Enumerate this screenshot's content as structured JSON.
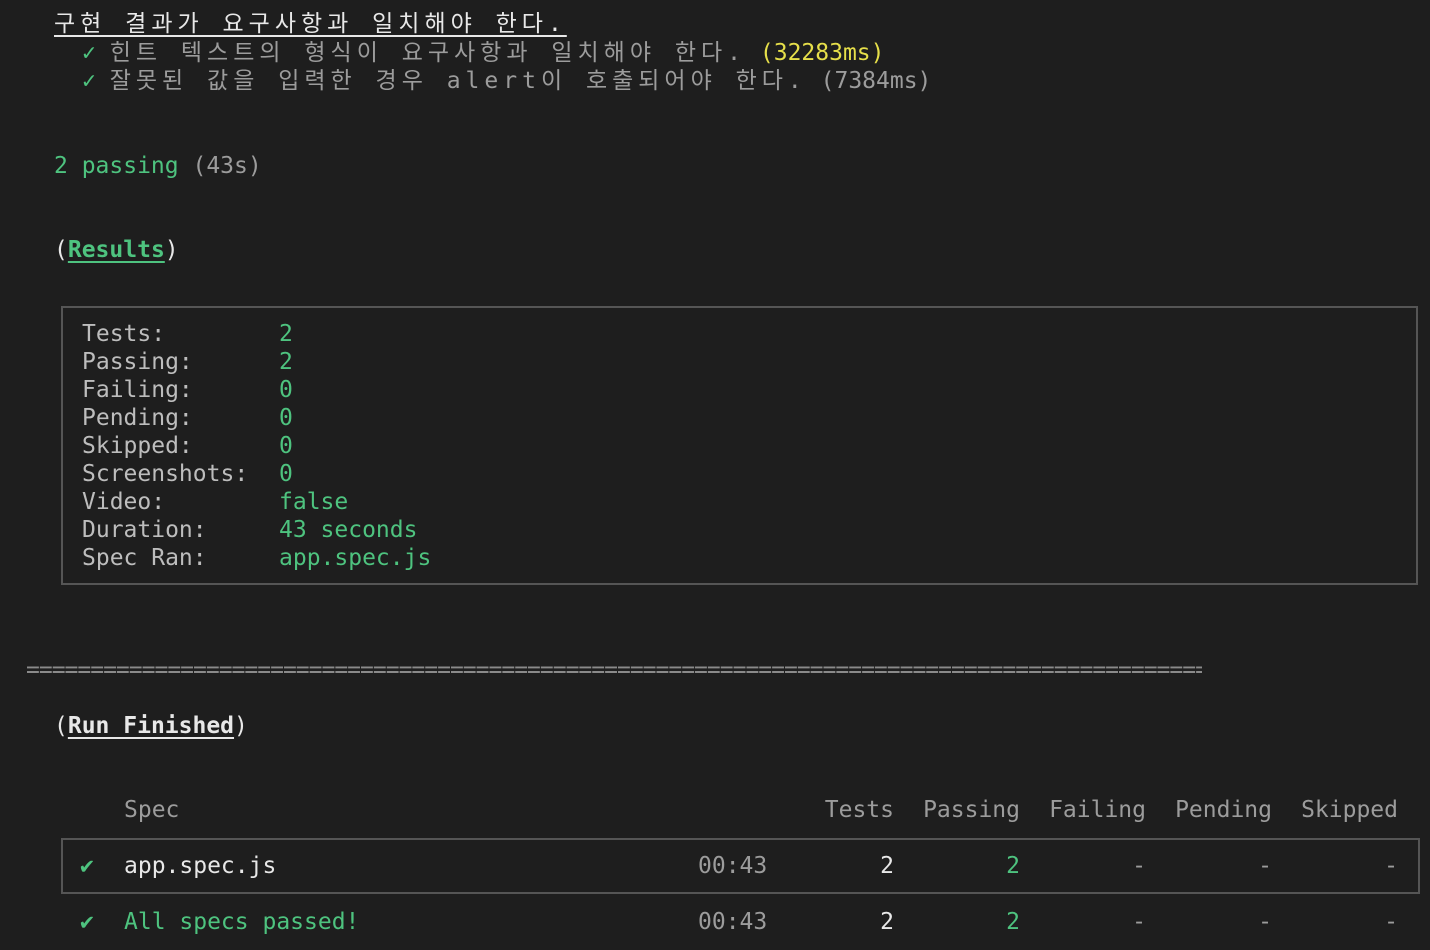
{
  "suite": {
    "title": "구현 결과가 요구사항과 일치해야 한다.",
    "tests": [
      {
        "check": "✓",
        "name": "힌트 텍스트의 형식이 요구사항과 일치해야 한다.",
        "duration": "(32283ms)"
      },
      {
        "check": "✓",
        "name": "잘못된 값을 입력한 경우 alert이 호출되어야 한다.",
        "duration": "(7384ms)"
      }
    ]
  },
  "summary": {
    "passing": "2 passing",
    "time": "(43s)"
  },
  "results": {
    "open_paren": "(",
    "heading": "Results",
    "close_paren": ")",
    "rows": [
      {
        "label": "Tests:",
        "value": "2"
      },
      {
        "label": "Passing:",
        "value": "2"
      },
      {
        "label": "Failing:",
        "value": "0"
      },
      {
        "label": "Pending:",
        "value": "0"
      },
      {
        "label": "Skipped:",
        "value": "0"
      },
      {
        "label": "Screenshots:",
        "value": "0"
      },
      {
        "label": "Video:",
        "value": "false"
      },
      {
        "label": "Duration:",
        "value": "43 seconds"
      },
      {
        "label": "Spec Ran:",
        "value": "app.spec.js"
      }
    ]
  },
  "separator": "====================================================================================================================================",
  "run_finished": {
    "open_paren": "(",
    "heading": "Run Finished",
    "close_paren": ")",
    "columns": {
      "spec": "Spec",
      "tests": "Tests",
      "passing": "Passing",
      "failing": "Failing",
      "pending": "Pending",
      "skipped": "Skipped"
    },
    "rows": [
      {
        "check": "✔",
        "spec": "app.spec.js",
        "time": "00:43",
        "tests": "2",
        "passing": "2",
        "failing": "-",
        "pending": "-",
        "skipped": "-"
      },
      {
        "check": "✔",
        "spec": "All specs passed!",
        "time": "00:43",
        "tests": "2",
        "passing": "2",
        "failing": "-",
        "pending": "-",
        "skipped": "-"
      }
    ]
  },
  "colors": {
    "background": "#1e1e1e",
    "green": "#4ec37f",
    "yellow": "#e6df4a",
    "gray": "#9c9c9c",
    "border": "#555555"
  }
}
